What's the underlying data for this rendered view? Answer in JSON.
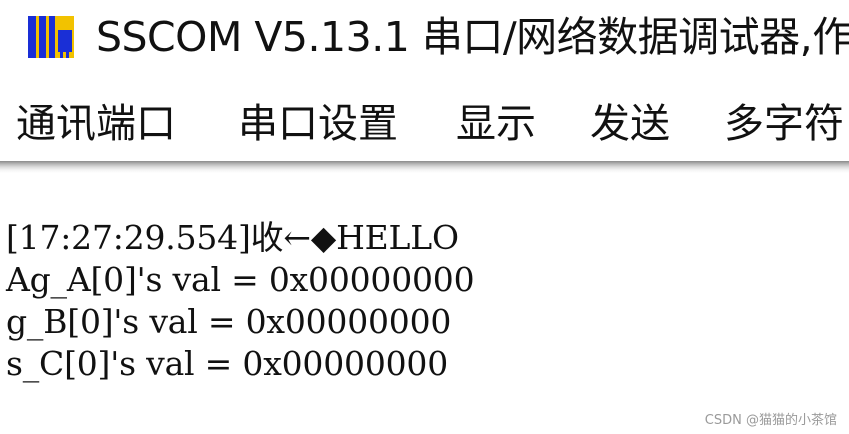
{
  "titlebar": {
    "icon": "sscom-app-icon",
    "title": "SSCOM V5.13.1 串口/网络数据调试器,作"
  },
  "menubar": {
    "items": [
      {
        "label": "通讯端口"
      },
      {
        "label": "串口设置"
      },
      {
        "label": "显示"
      },
      {
        "label": "发送"
      },
      {
        "label": "多字符"
      }
    ]
  },
  "receive": {
    "lines": [
      "[17:27:29.554]收←◆HELLO",
      "Ag_A[0]'s val = 0x00000000",
      "g_B[0]'s val = 0x00000000",
      "s_C[0]'s val = 0x00000000"
    ]
  },
  "watermark": "CSDN @猫猫的小茶馆",
  "colors": {
    "icon_blue": "#1a2fd6",
    "icon_yellow": "#f2c200",
    "text": "#111111"
  }
}
